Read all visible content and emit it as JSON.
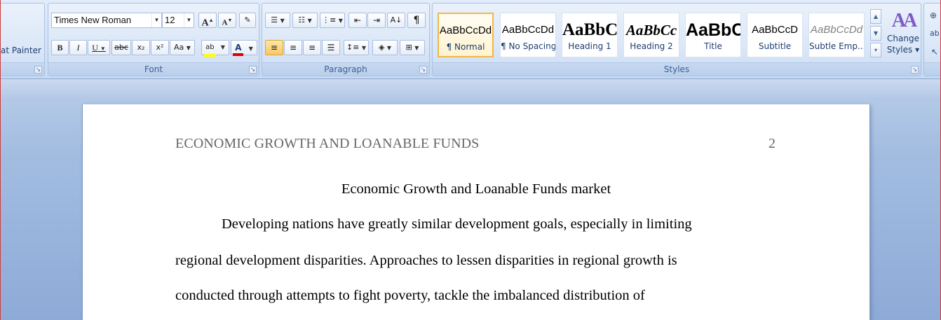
{
  "ribbon": {
    "clipboard": {
      "format_painter_label": "at Painter"
    },
    "font": {
      "group_label": "Font",
      "font_name": "Times New Roman",
      "font_size": "12",
      "grow_label": "A",
      "shrink_label": "A",
      "bold": "B",
      "italic": "I",
      "underline": "U",
      "strikethrough": "abc",
      "subscript": "x₂",
      "superscript": "x²",
      "change_case": "Aa",
      "highlight_label": "ab",
      "font_color_label": "A",
      "highlight_color": "#ffff00",
      "font_color": "#e00000"
    },
    "paragraph": {
      "group_label": "Paragraph",
      "show_marks_label": "¶"
    },
    "styles": {
      "group_label": "Styles",
      "tiles": [
        {
          "sample": "AaBbCcDd",
          "name": "¶ Normal",
          "selected": true
        },
        {
          "sample": "AaBbCcDd",
          "name": "¶ No Spacing",
          "selected": false
        },
        {
          "sample": "AaBbC",
          "name": "Heading 1",
          "selected": false
        },
        {
          "sample": "AaBbCc",
          "name": "Heading 2",
          "selected": false
        },
        {
          "sample": "AaBbC",
          "name": "Title",
          "selected": false
        },
        {
          "sample": "AaBbCcD",
          "name": "Subtitle",
          "selected": false
        },
        {
          "sample": "AaBbCcDd",
          "name": "Subtle Emp...",
          "selected": false
        }
      ],
      "change_styles_label_1": "Change",
      "change_styles_label_2": "Styles ▾"
    }
  },
  "document": {
    "running_head": "ECONOMIC GROWTH AND LOANABLE FUNDS",
    "page_number": "2",
    "title": "Economic Growth and Loanable Funds market",
    "lines": [
      "Developing nations have greatly similar development goals, especially in limiting",
      "regional development disparities. Approaches to lessen disparities in regional growth is",
      "conducted through attempts to fight poverty, tackle the imbalanced distribution of"
    ]
  }
}
